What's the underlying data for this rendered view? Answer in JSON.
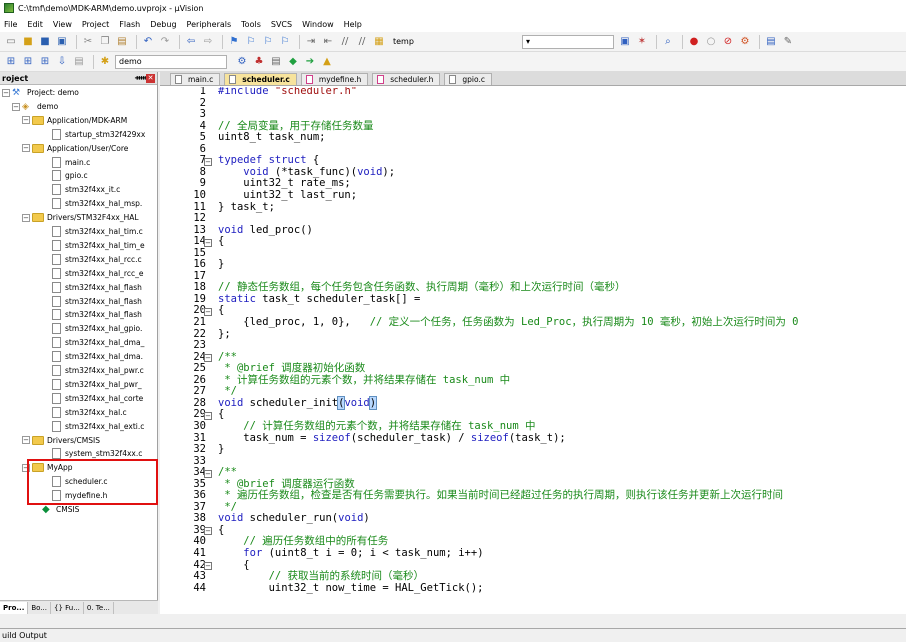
{
  "window": {
    "title": "C:\\tmf\\demo\\MDK-ARM\\demo.uvprojx - µVision"
  },
  "menu": [
    "File",
    "Edit",
    "View",
    "Project",
    "Flash",
    "Debug",
    "Peripherals",
    "Tools",
    "SVCS",
    "Window",
    "Help"
  ],
  "toolbar": {
    "target": "temp",
    "build_target": "demo"
  },
  "project_panel": {
    "title": "roject",
    "tabs": [
      "Pro...",
      "Bo...",
      "{} Fu...",
      "0. Te..."
    ]
  },
  "tree": {
    "project": "Project: demo",
    "target": "demo",
    "groups": [
      {
        "name": "Application/MDK-ARM",
        "files": [
          "startup_stm32f429xx"
        ]
      },
      {
        "name": "Application/User/Core",
        "files": [
          "main.c",
          "gpio.c",
          "stm32f4xx_it.c",
          "stm32f4xx_hal_msp."
        ]
      },
      {
        "name": "Drivers/STM32F4xx_HAL",
        "files": [
          "stm32f4xx_hal_tim.c",
          "stm32f4xx_hal_tim_e",
          "stm32f4xx_hal_rcc.c",
          "stm32f4xx_hal_rcc_e",
          "stm32f4xx_hal_flash",
          "stm32f4xx_hal_flash",
          "stm32f4xx_hal_flash",
          "stm32f4xx_hal_gpio.",
          "stm32f4xx_hal_dma_",
          "stm32f4xx_hal_dma.",
          "stm32f4xx_hal_pwr.c",
          "stm32f4xx_hal_pwr_",
          "stm32f4xx_hal_corte",
          "stm32f4xx_hal.c",
          "stm32f4xx_hal_exti.c"
        ]
      },
      {
        "name": "Drivers/CMSIS",
        "files": [
          "system_stm32f4xx.c"
        ]
      },
      {
        "name": "MyApp",
        "files": [
          "scheduler.c",
          "mydefine.h"
        ]
      }
    ],
    "cmsis": "CMSIS"
  },
  "editor_tabs": [
    "main.c",
    "scheduler.c",
    "mydefine.h",
    "scheduler.h",
    "gpio.c"
  ],
  "code_lines": [
    {
      "n": "1",
      "t": "#include \"scheduler.h\""
    },
    {
      "n": "2",
      "t": ""
    },
    {
      "n": "3",
      "t": ""
    },
    {
      "n": "4",
      "t": "// 全局变量，用于存储任务数量"
    },
    {
      "n": "5",
      "t": "uint8_t task_num;"
    },
    {
      "n": "6",
      "t": ""
    },
    {
      "n": "7",
      "t": "typedef struct {"
    },
    {
      "n": "8",
      "t": "    void (*task_func)(void);"
    },
    {
      "n": "9",
      "t": "    uint32_t rate_ms;"
    },
    {
      "n": "10",
      "t": "    uint32_t last_run;"
    },
    {
      "n": "11",
      "t": "} task_t;"
    },
    {
      "n": "12",
      "t": ""
    },
    {
      "n": "13",
      "t": "void led_proc()"
    },
    {
      "n": "14",
      "t": "{"
    },
    {
      "n": "15",
      "t": ""
    },
    {
      "n": "16",
      "t": "}"
    },
    {
      "n": "17",
      "t": ""
    },
    {
      "n": "18",
      "t": "// 静态任务数组，每个任务包含任务函数、执行周期（毫秒）和上次运行时间（毫秒）"
    },
    {
      "n": "19",
      "t": "static task_t scheduler_task[] ="
    },
    {
      "n": "20",
      "t": "{"
    },
    {
      "n": "21",
      "t": "    {led_proc, 1, 0},   // 定义一个任务，任务函数为 Led_Proc，执行周期为 10 毫秒，初始上次运行时间为 0"
    },
    {
      "n": "22",
      "t": "};"
    },
    {
      "n": "23",
      "t": ""
    },
    {
      "n": "24",
      "t": "/**"
    },
    {
      "n": "25",
      "t": " * @brief 调度器初始化函数"
    },
    {
      "n": "26",
      "t": " * 计算任务数组的元素个数，并将结果存储在 task_num 中"
    },
    {
      "n": "27",
      "t": " */"
    },
    {
      "n": "28",
      "t": "void scheduler_init(void)"
    },
    {
      "n": "29",
      "t": "{"
    },
    {
      "n": "30",
      "t": "    // 计算任务数组的元素个数，并将结果存储在 task_num 中"
    },
    {
      "n": "31",
      "t": "    task_num = sizeof(scheduler_task) / sizeof(task_t);"
    },
    {
      "n": "32",
      "t": "}"
    },
    {
      "n": "33",
      "t": ""
    },
    {
      "n": "34",
      "t": "/**"
    },
    {
      "n": "35",
      "t": " * @brief 调度器运行函数"
    },
    {
      "n": "36",
      "t": " * 遍历任务数组，检查是否有任务需要执行。如果当前时间已经超过任务的执行周期，则执行该任务并更新上次运行时间"
    },
    {
      "n": "37",
      "t": " */"
    },
    {
      "n": "38",
      "t": "void scheduler_run(void)"
    },
    {
      "n": "39",
      "t": "{"
    },
    {
      "n": "40",
      "t": "    // 遍历任务数组中的所有任务"
    },
    {
      "n": "41",
      "t": "    for (uint8_t i = 0; i < task_num; i++)"
    },
    {
      "n": "42",
      "t": "    {"
    },
    {
      "n": "43",
      "t": "        // 获取当前的系统时间（毫秒）"
    },
    {
      "n": "44",
      "t": "        uint32_t now_time = HAL_GetTick();"
    }
  ],
  "build_output": {
    "label": "uild Output"
  },
  "colors": {
    "keyword": "#2020c0",
    "comment": "#1a8a1a",
    "string": "#a01010",
    "active_tab": "#f7e39c",
    "highlight_box": "#e01010"
  }
}
